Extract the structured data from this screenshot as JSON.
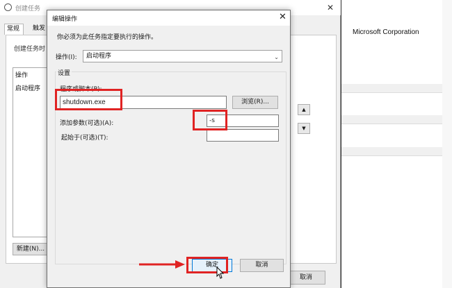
{
  "background_window": {
    "title": "创建任务",
    "tabs": [
      "常规",
      "触发"
    ],
    "description": "创建任务时",
    "list_header": "操作",
    "list_row": "启动程序",
    "new_button": "新建(N)...",
    "cancel_button": "取消"
  },
  "right_pane": {
    "publisher": "Microsoft Corporation"
  },
  "dialog": {
    "title": "编辑操作",
    "instruction": "你必须为此任务指定要执行的操作。",
    "action_label": "操作(I):",
    "action_value": "启动程序",
    "settings_title": "设置",
    "program_label": "程序或脚本(P):",
    "program_value": "shutdown.exe",
    "browse_button": "浏览(R)...",
    "args_label": "添加参数(可选)(A):",
    "args_value": "-s",
    "start_in_label": "起始于(可选)(T):",
    "start_in_value": "",
    "ok_button": "确定",
    "cancel_button": "取消"
  },
  "colors": {
    "highlight": "#e02323",
    "ok_border": "#0078d7"
  },
  "icons": [
    "close-icon",
    "chevron-down-icon",
    "arrow-icon",
    "mouse-cursor-icon"
  ]
}
